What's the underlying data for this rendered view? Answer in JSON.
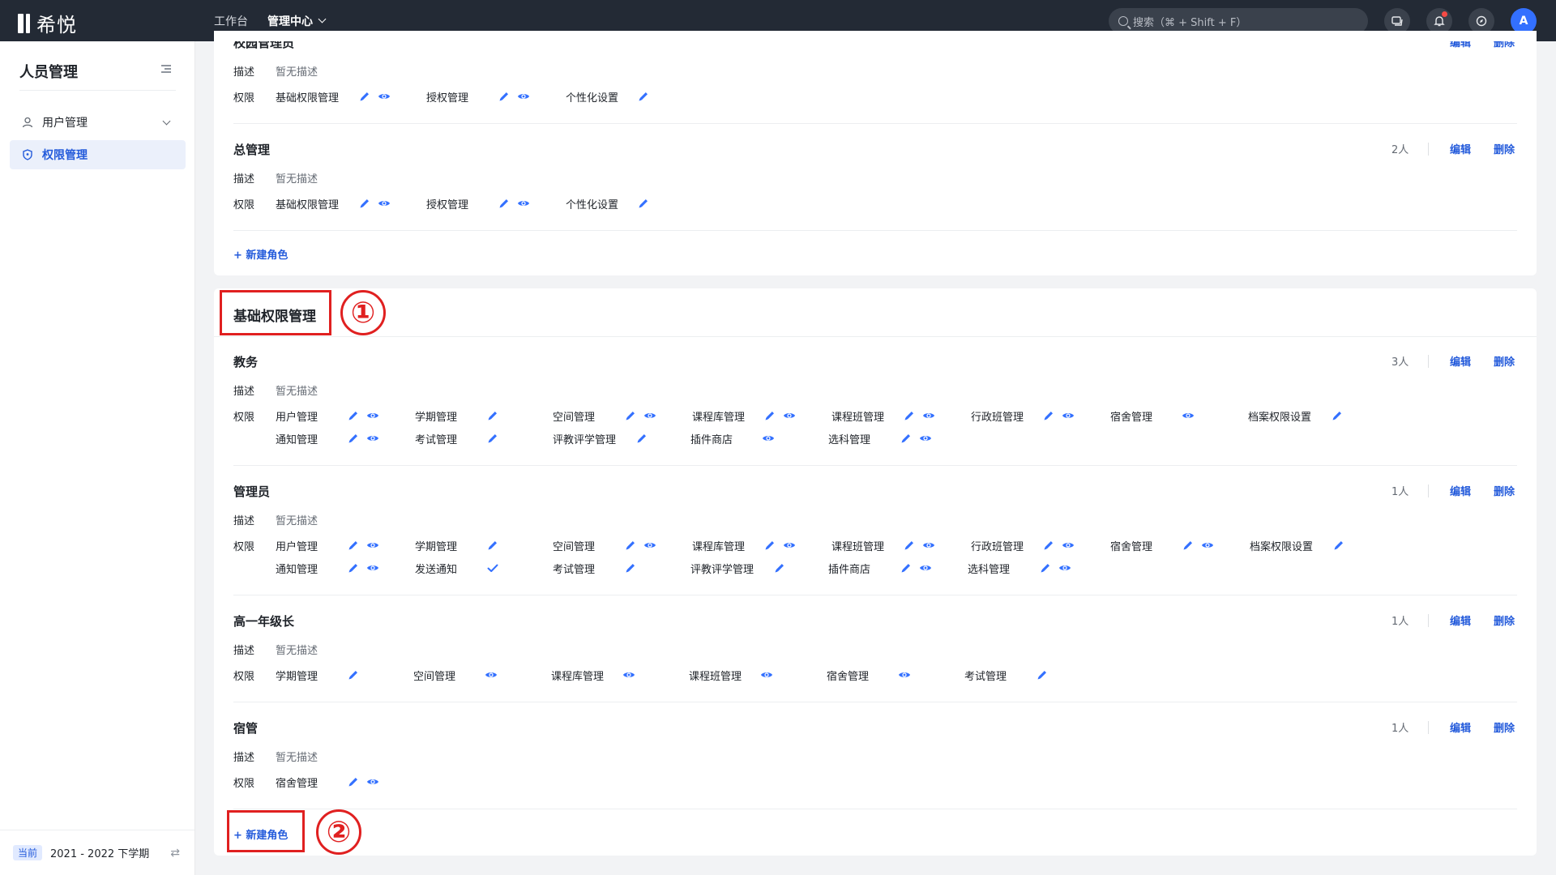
{
  "brand": {
    "name": "希悦"
  },
  "nav": {
    "workbench": "工作台",
    "manage": "管理中心"
  },
  "search": {
    "placeholder": "搜索（⌘ + Shift + F）"
  },
  "user": {
    "avatar": "A"
  },
  "sidebar": {
    "title": "人员管理",
    "items": [
      {
        "label": "用户管理"
      },
      {
        "label": "权限管理"
      }
    ],
    "footer": {
      "badge": "当前",
      "term": "2021 - 2022 下学期"
    }
  },
  "labels": {
    "desc": "描述",
    "perm": "权限",
    "no_desc": "暂无描述",
    "edit": "编辑",
    "delete": "删除",
    "new_role": "+ 新建角色"
  },
  "card1": {
    "partial_name": "校园管理员",
    "roles": [
      {
        "name": "总管理",
        "count": "2人",
        "perms": [
          "基础权限管理",
          "授权管理",
          "个性化设置"
        ]
      }
    ],
    "first_perms": [
      "基础权限管理",
      "授权管理",
      "个性化设置"
    ]
  },
  "section2": {
    "title": "基础权限管理",
    "roles": [
      {
        "name": "教务",
        "count": "3人",
        "row1": [
          "用户管理",
          "学期管理",
          "空间管理",
          "课程库管理",
          "课程班管理",
          "行政班管理",
          "宿舍管理",
          "档案权限设置"
        ],
        "row2": [
          "通知管理",
          "考试管理",
          "评教评学管理",
          "插件商店",
          "选科管理"
        ]
      },
      {
        "name": "管理员",
        "count": "1人",
        "row1": [
          "用户管理",
          "学期管理",
          "空间管理",
          "课程库管理",
          "课程班管理",
          "行政班管理",
          "宿舍管理",
          "档案权限设置"
        ],
        "row2": [
          "通知管理",
          "发送通知",
          "考试管理",
          "评教评学管理",
          "插件商店",
          "选科管理"
        ]
      },
      {
        "name": "高一年级长",
        "count": "1人",
        "row1": [
          "学期管理",
          "空间管理",
          "课程库管理",
          "课程班管理",
          "宿舍管理",
          "考试管理"
        ]
      },
      {
        "name": "宿管",
        "count": "1人",
        "row1": [
          "宿舍管理"
        ]
      }
    ]
  },
  "annotations": {
    "one": "①",
    "two": "②"
  },
  "colors": {
    "accent": "#245bdb",
    "topbar": "#232a35",
    "annotation": "#e02020"
  }
}
